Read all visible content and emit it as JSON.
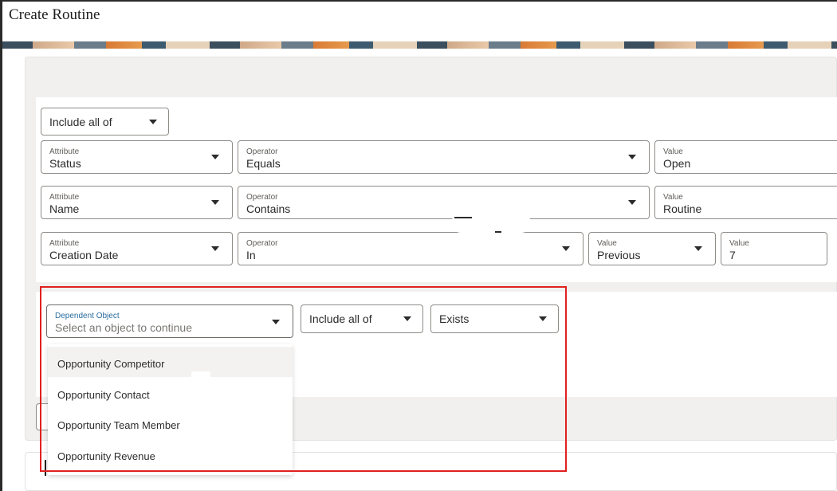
{
  "page": {
    "title": "Create Routine"
  },
  "conditions": {
    "match_mode": "Include all of",
    "rows": [
      {
        "attribute_label": "Attribute",
        "attribute": "Status",
        "operator_label": "Operator",
        "operator": "Equals",
        "value_label": "Value",
        "value": "Open"
      },
      {
        "attribute_label": "Attribute",
        "attribute": "Name",
        "operator_label": "Operator",
        "operator": "Contains",
        "value_label": "Value",
        "value": "Routine"
      },
      {
        "attribute_label": "Attribute",
        "attribute": "Creation Date",
        "operator_label": "Operator",
        "operator": "In",
        "value_label": "Value",
        "value": "Previous",
        "value2_label": "Value",
        "value2": "7"
      }
    ]
  },
  "dependent": {
    "label": "Dependent Object",
    "placeholder": "Select an object to continue",
    "match_mode": "Include all of",
    "existence": "Exists",
    "options": [
      "Opportunity Competitor",
      "Opportunity Contact",
      "Opportunity Team Member",
      "Opportunity Revenue"
    ]
  },
  "colors": {
    "highlight": "#e02020",
    "dependent_label": "#2a6d9e",
    "panel_bg": "#f1f0ef"
  }
}
